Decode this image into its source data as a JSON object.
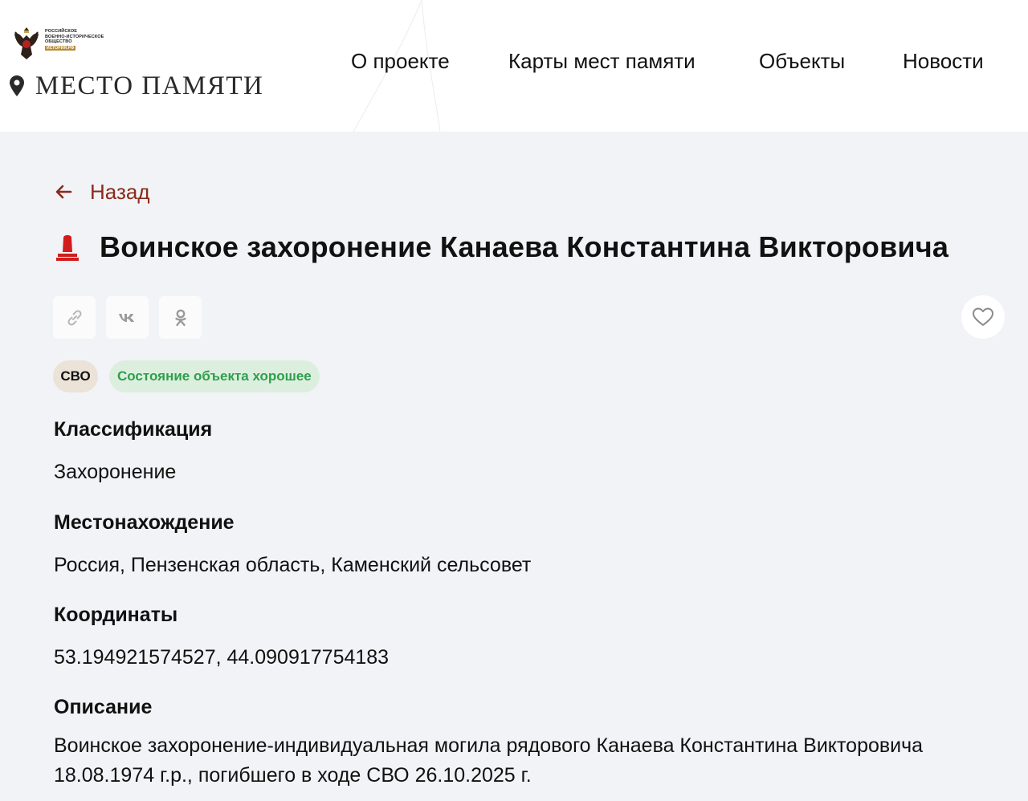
{
  "header": {
    "society_lines": [
      "Российское",
      "военно-историческое",
      "общество"
    ],
    "society_tag": "ИСТОРИЯ.РФ",
    "site_title": "МЕСТО ПАМЯТИ",
    "nav": [
      "О проекте",
      "Карты мест памяти",
      "Объекты",
      "Новости"
    ]
  },
  "main": {
    "back_label": "Назад",
    "title": "Воинское захоронение Канаева Константина Викторовича",
    "share_buttons": [
      "link-icon",
      "vk-icon",
      "ok-icon"
    ],
    "badges": {
      "category": "СВО",
      "state": "Состояние объекта хорошее"
    },
    "sections": [
      {
        "label": "Классификация",
        "value": "Захоронение"
      },
      {
        "label": "Местонахождение",
        "value": "Россия, Пензенская область, Каменский сельсовет"
      },
      {
        "label": "Координаты",
        "value": "53.194921574527, 44.090917754183"
      },
      {
        "label": "Описание",
        "value": "Воинское захоронение-индивидуальная могила рядового Канаева Константина Викторовича 18.08.1974 г.р., погибшего в ходе СВО 26.10.2025 г."
      }
    ]
  },
  "colors": {
    "accent": "#8a2a1c",
    "monument_red": "#d21c1c",
    "state_green": "#2e9f4b",
    "state_bg": "#dcefdf",
    "svo_bg": "#ebe2d8",
    "page_bg": "#f2f3f6"
  }
}
